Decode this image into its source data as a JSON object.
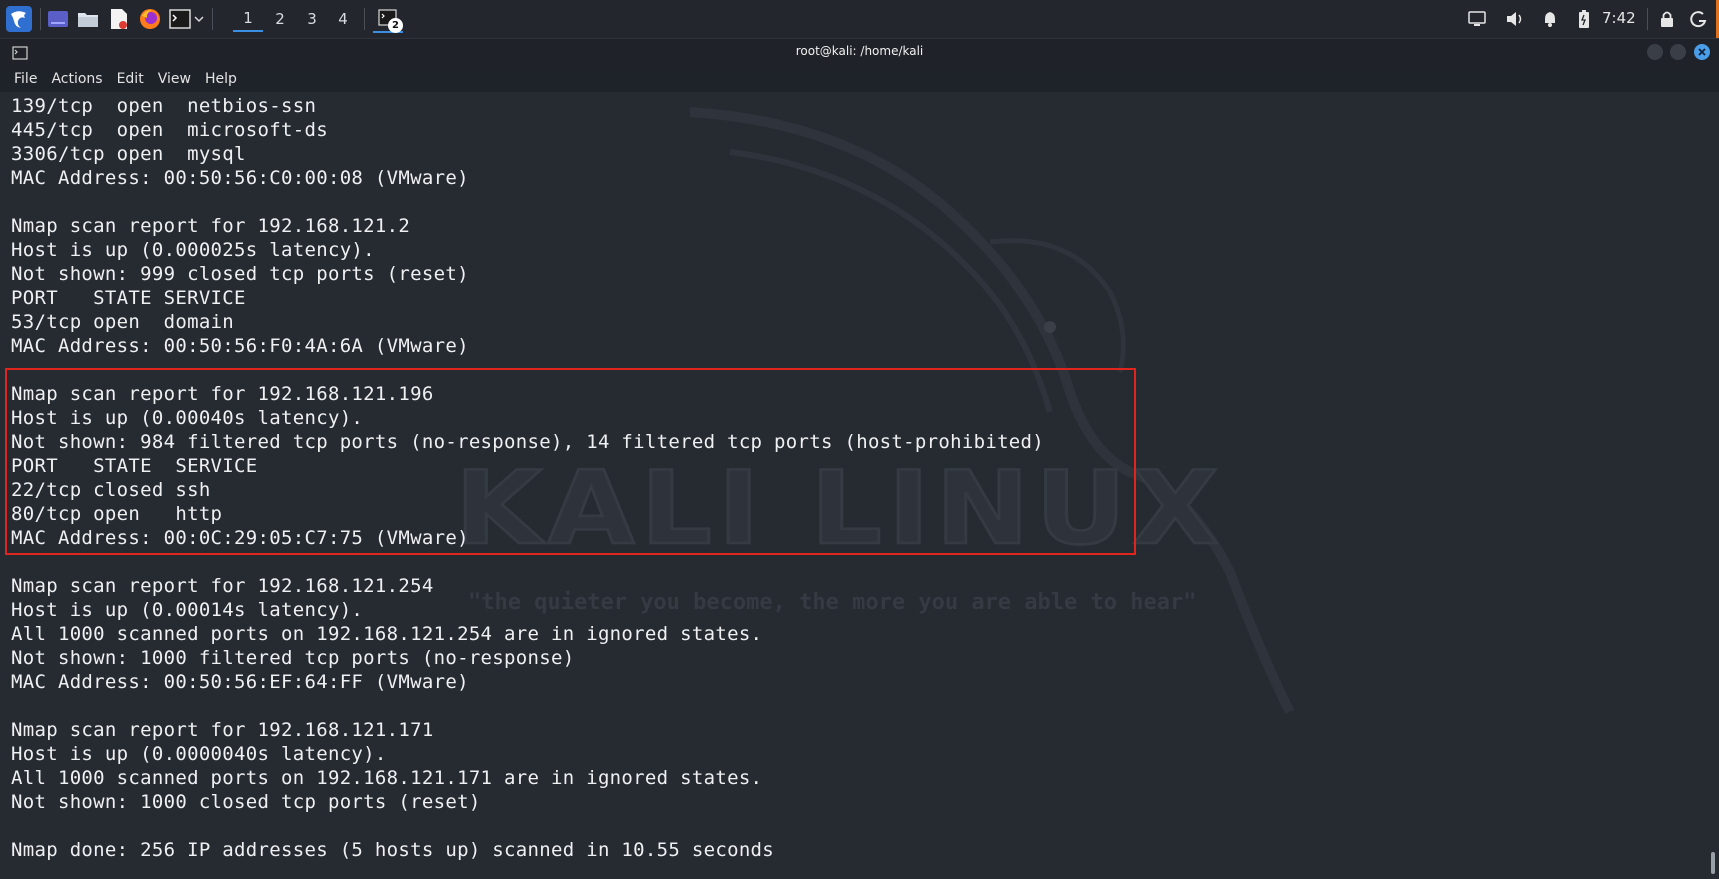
{
  "panel": {
    "workspaces": [
      "1",
      "2",
      "3",
      "4"
    ],
    "active_workspace": "1",
    "taskbar_badge": "2",
    "clock": "7:42",
    "icons": [
      "kali-menu-icon",
      "desktop-icon",
      "file-manager-icon",
      "text-editor-icon",
      "firefox-icon",
      "terminal-icon",
      "dropdown-icon",
      "display-icon",
      "volume-icon",
      "notification-bell-icon",
      "battery-icon",
      "lock-icon",
      "power-icon"
    ]
  },
  "window": {
    "title": "root@kali: /home/kali",
    "menu": [
      "File",
      "Actions",
      "Edit",
      "View",
      "Help"
    ]
  },
  "wallpaper": {
    "logo_text": "KALI LINUX",
    "quote": "\"the quieter you become, the more you are able to hear\""
  },
  "terminal": {
    "lines": [
      "139/tcp  open  netbios-ssn",
      "445/tcp  open  microsoft-ds",
      "3306/tcp open  mysql",
      "MAC Address: 00:50:56:C0:00:08 (VMware)",
      "",
      "Nmap scan report for 192.168.121.2",
      "Host is up (0.000025s latency).",
      "Not shown: 999 closed tcp ports (reset)",
      "PORT   STATE SERVICE",
      "53/tcp open  domain",
      "MAC Address: 00:50:56:F0:4A:6A (VMware)",
      "",
      "Nmap scan report for 192.168.121.196",
      "Host is up (0.00040s latency).",
      "Not shown: 984 filtered tcp ports (no-response), 14 filtered tcp ports (host-prohibited)",
      "PORT   STATE  SERVICE",
      "22/tcp closed ssh",
      "80/tcp open   http",
      "MAC Address: 00:0C:29:05:C7:75 (VMware)",
      "",
      "Nmap scan report for 192.168.121.254",
      "Host is up (0.00014s latency).",
      "All 1000 scanned ports on 192.168.121.254 are in ignored states.",
      "Not shown: 1000 filtered tcp ports (no-response)",
      "MAC Address: 00:50:56:EF:64:FF (VMware)",
      "",
      "Nmap scan report for 192.168.121.171",
      "Host is up (0.0000040s latency).",
      "All 1000 scanned ports on 192.168.121.171 are in ignored states.",
      "Not shown: 1000 closed tcp ports (reset)",
      "",
      "Nmap done: 256 IP addresses (5 hosts up) scanned in 10.55 seconds"
    ]
  },
  "colors": {
    "highlight_box": "#e0261c",
    "active_workspace": "#3b8fe3",
    "terminal_bg": "#262a31",
    "text": "#eef0f2"
  }
}
